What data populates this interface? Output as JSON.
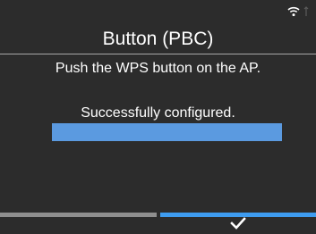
{
  "screen": {
    "title": "Button (PBC)",
    "instruction": "Push the WPS button on the AP.",
    "status": "Successfully configured.",
    "progress_percent": 100
  },
  "status_bar": {
    "icons": [
      "wifi-icon",
      "signal-icon"
    ]
  },
  "softkeys": {
    "left": {
      "label": "",
      "color": "#8f8f8f"
    },
    "right": {
      "icon": "checkmark-icon",
      "color": "#3e9cf0"
    }
  },
  "colors": {
    "background": "#2c2c2c",
    "accent": "#3e9cf0",
    "progress": "#5b9ae0"
  }
}
